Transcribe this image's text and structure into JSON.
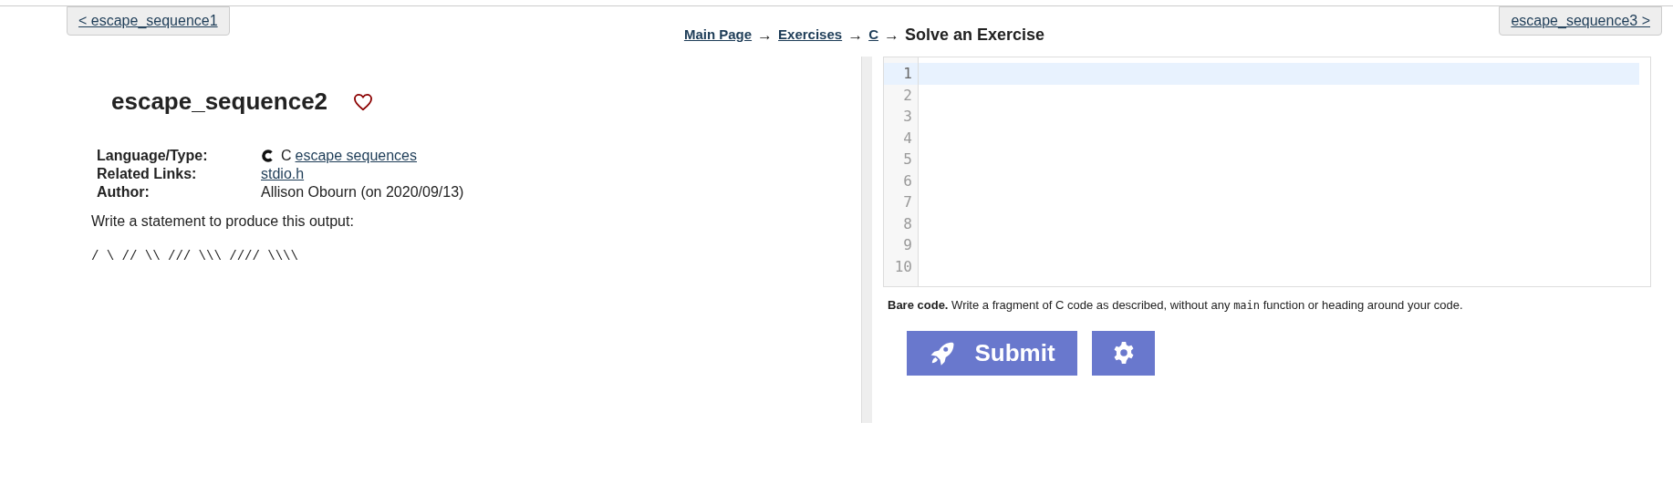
{
  "nav": {
    "previous": "< escape_sequence1",
    "next": "escape_sequence3 >"
  },
  "breadcrumb": {
    "links": [
      "Main Page",
      "Exercises",
      "C"
    ],
    "separator": "→",
    "current": "Solve an Exercise"
  },
  "problem": {
    "title": "escape_sequence2",
    "favorite": false,
    "info": [
      {
        "label": "Language/Type:",
        "kind": "language",
        "text": "C",
        "link": "escape sequences"
      },
      {
        "label": "Related Links:",
        "kind": "link",
        "link": "stdio.h"
      },
      {
        "label": "Author:",
        "kind": "text",
        "text": "Allison Obourn (on 2020/09/13)"
      }
    ],
    "description": "Write a statement to produce this output:",
    "output": "/ \\ // \\\\ /// \\\\\\ //// \\\\\\\\"
  },
  "editor": {
    "lines": [
      {
        "number": "1",
        "active": true
      },
      {
        "number": "2",
        "active": false
      },
      {
        "number": "3",
        "active": false
      },
      {
        "number": "4",
        "active": false
      },
      {
        "number": "5",
        "active": false
      },
      {
        "number": "6",
        "active": false
      },
      {
        "number": "7",
        "active": false
      },
      {
        "number": "8",
        "active": false
      },
      {
        "number": "9",
        "active": false
      },
      {
        "number": "10",
        "active": false
      }
    ]
  },
  "note": [
    {
      "kind": "bold",
      "text": "Bare code."
    },
    {
      "kind": "text",
      "text": " Write a fragment of C code as described, without any "
    },
    {
      "kind": "code",
      "text": "main"
    },
    {
      "kind": "text",
      "text": " function or heading around your code."
    }
  ],
  "submit": {
    "label": "Submit"
  }
}
